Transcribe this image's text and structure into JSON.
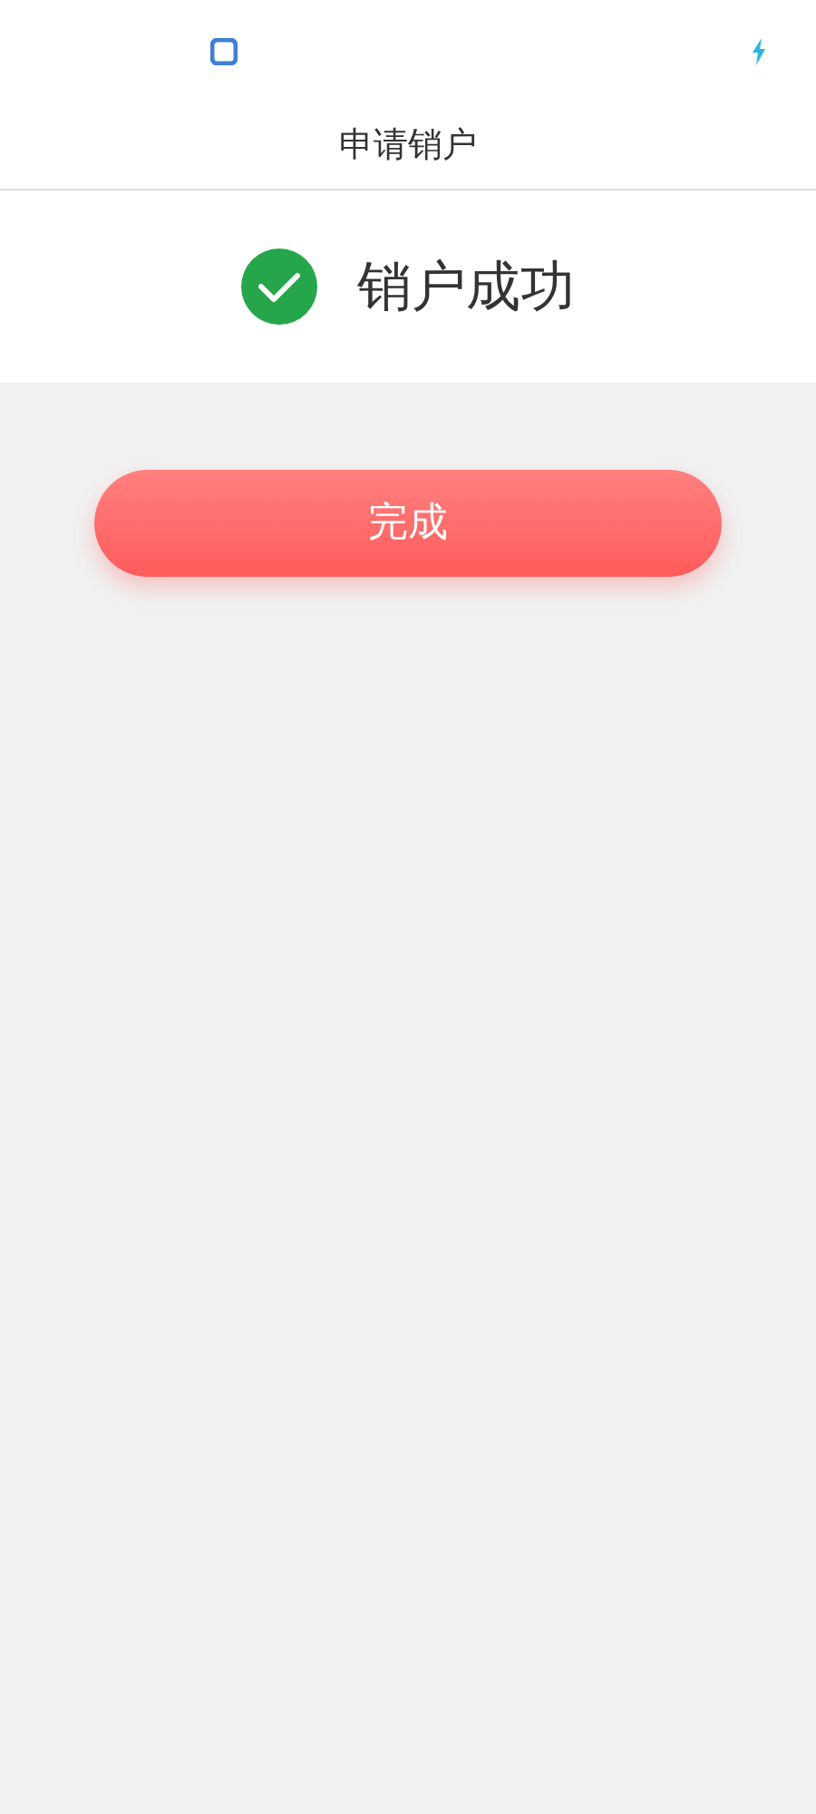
{
  "header": {
    "title": "申请销户"
  },
  "result": {
    "message": "销户成功"
  },
  "button": {
    "label": "完成"
  }
}
